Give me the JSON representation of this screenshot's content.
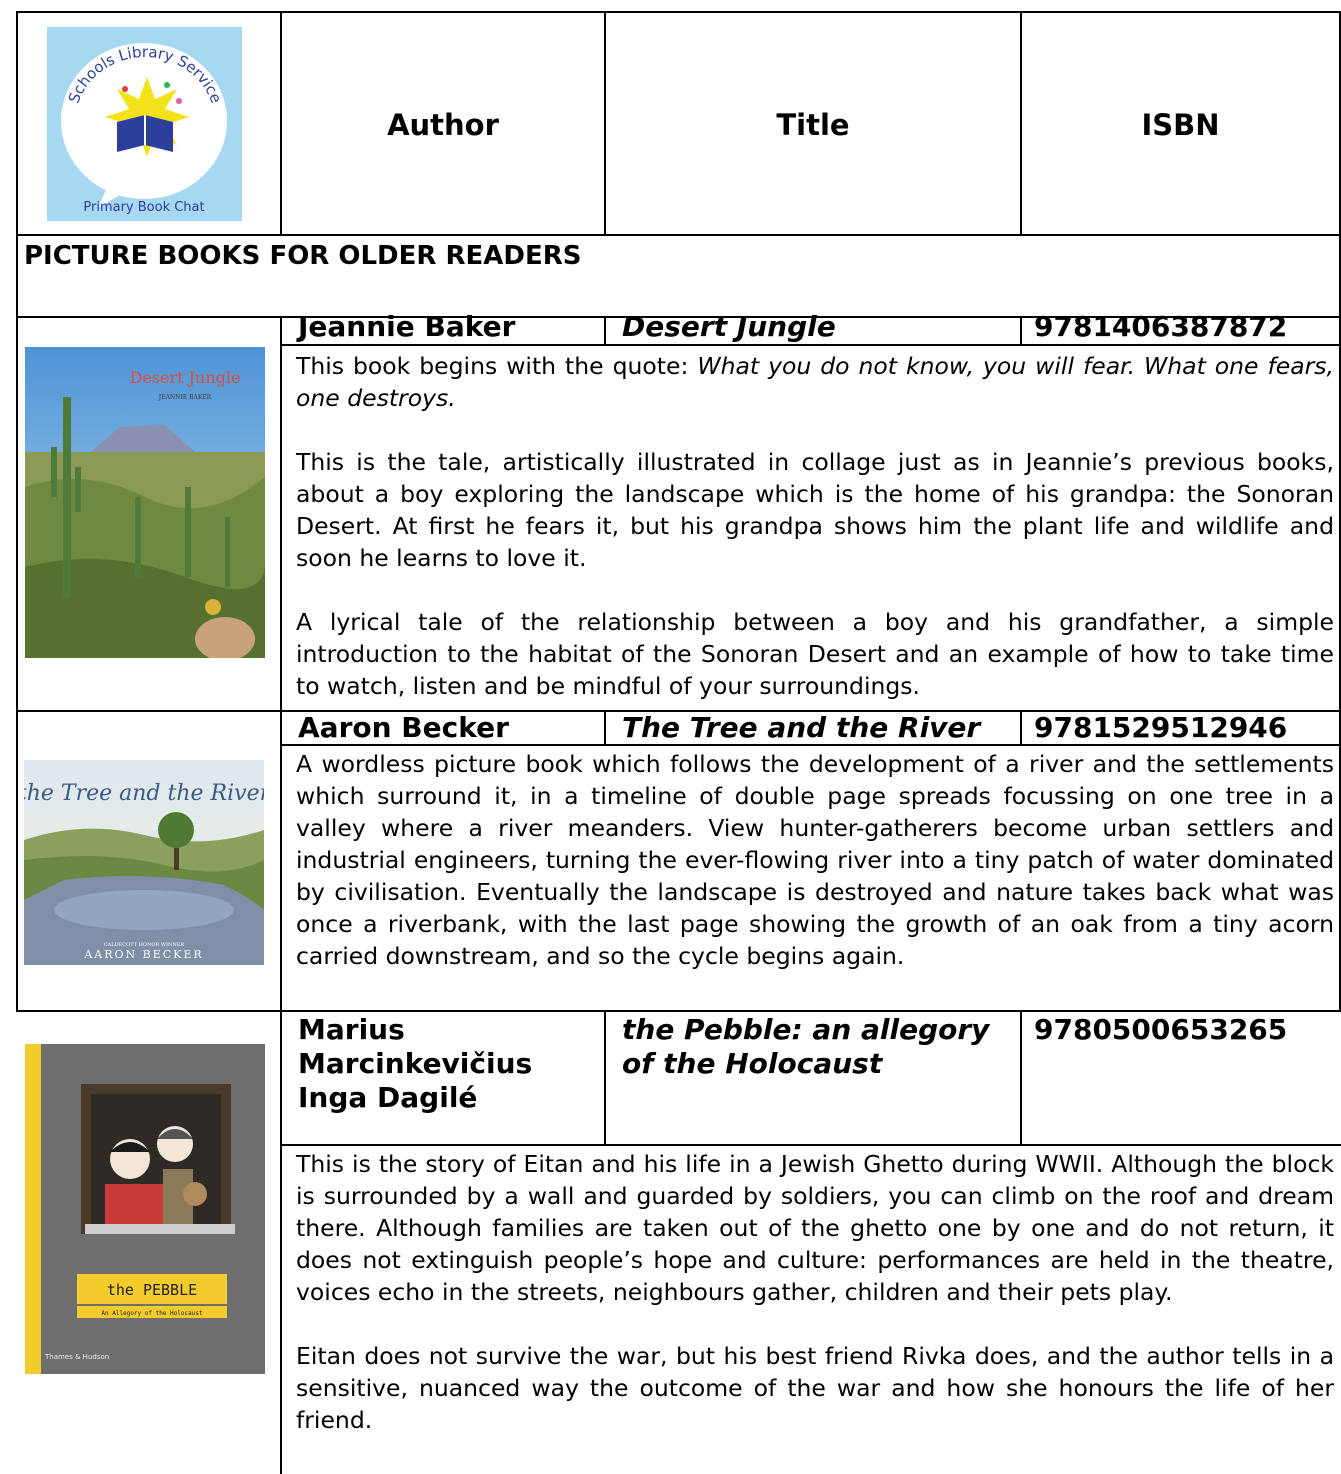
{
  "logo": {
    "top_text": "Schools Library Service",
    "bottom_text": "Primary Book Chat",
    "bg_color": "#a7d8f2",
    "accent_color": "#f2e21a"
  },
  "header": {
    "author": "Author",
    "title": "Title",
    "isbn": "ISBN"
  },
  "section_title": "PICTURE BOOKS FOR OLDER READERS",
  "books": [
    {
      "author": "Jeannie Baker",
      "title": "Desert Jungle",
      "isbn": "9781406387872",
      "cover": {
        "title": "Desert Jungle",
        "author": "JEANNIE BAKER"
      },
      "desc": {
        "p1_prefix": "This book begins with the quote: ",
        "p1_quote": "What you do not know, you will fear. What one fears, one destroys.",
        "p2": "This is the tale, artistically illustrated in collage just as in Jeannie’s previous books, about a boy exploring the landscape which is the home of his grandpa: the Sonoran Desert. At first he fears it, but his grandpa shows him the plant life and wildlife and soon he learns to love it.",
        "p3": "A lyrical tale of the relationship between a boy and his grandfather, a simple introduction to the habitat of the Sonoran Desert and an example of how to take time to watch, listen and be mindful of your surroundings."
      }
    },
    {
      "author": "Aaron Becker",
      "title": "The Tree and the River",
      "isbn": "9781529512946",
      "cover": {
        "title": "the Tree and the River",
        "author": "AARON BECKER",
        "award": "CALDECOTT HONOR WINNER"
      },
      "desc": {
        "p1": "A wordless picture book which follows the development of a river and the settlements which surround it, in a timeline of double page spreads focussing on one tree in a valley where a river meanders. View hunter-gatherers become urban settlers and industrial engineers, turning the ever-flowing river into a tiny patch of water dominated by civilisation. Eventually the landscape is destroyed and nature takes back what was once a riverbank, with the last page showing the growth of an oak from a tiny acorn carried downstream, and so the cycle begins again."
      }
    },
    {
      "author_line1": "Marius",
      "author_line2": "Marcinkevičius",
      "author_line3": "Inga Dagilé",
      "title_line1": "the Pebble: an allegory",
      "title_line2": "of the Holocaust",
      "isbn": "9780500653265",
      "cover": {
        "title": "the PEBBLE",
        "subtitle": "An Allegory of the Holocaust",
        "publisher": "Thames & Hudson"
      },
      "desc": {
        "p1": "This is the story of Eitan and his life in a Jewish Ghetto during WWII. Although the block is surrounded by a wall and guarded by soldiers, you can climb on the roof and dream there. Although families are taken out of the ghetto one by one and do not return, it does not extinguish people’s hope and culture: performances are held in the theatre, voices echo in the streets, neighbours gather, children and their pets play.",
        "p2": "Eitan does not survive the war, but his best friend Rivka does, and the author tells in a sensitive, nuanced way the outcome of the war and how she honours the life of her friend."
      }
    }
  ]
}
